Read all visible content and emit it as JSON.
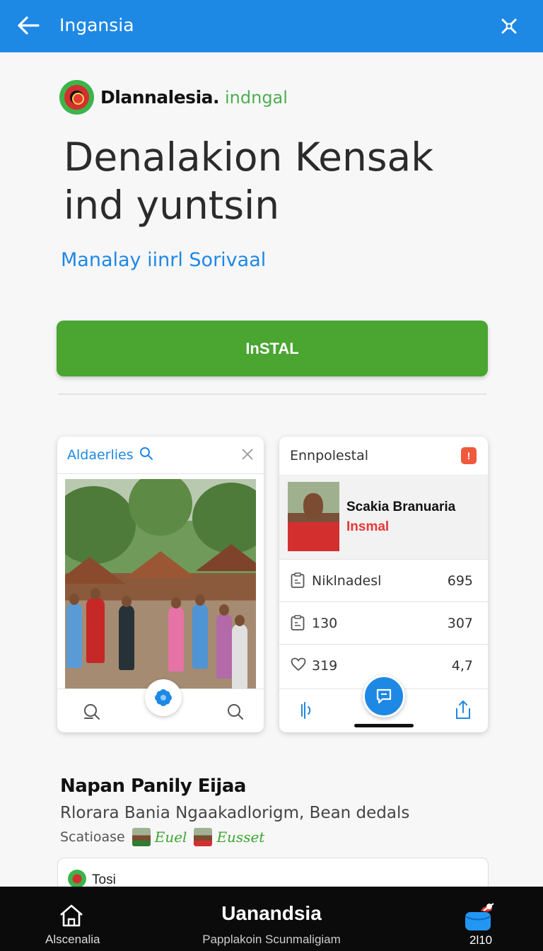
{
  "appbar": {
    "title": "Ingansia",
    "back_icon": "arrow-left-icon",
    "close_icon": "cross-icon"
  },
  "brand": {
    "name": "Dlannalesia.",
    "suffix": "indngal"
  },
  "headline": "Denalakion Kensak ind yuntsin",
  "subheadline": "Manalay iinrl Sorivaal",
  "install_label": "InSTAL",
  "screenshot_left": {
    "header_label": "Aldaerlies"
  },
  "screenshot_right": {
    "header_label": "Ennpolestal",
    "profile_name": "Scakia Branuaria",
    "profile_role": "Insmal",
    "rows": [
      {
        "label": "Niklnadesl",
        "value": "695",
        "icon": "clipboard-icon"
      },
      {
        "label": "130",
        "value": "307",
        "icon": "clipboard-icon"
      },
      {
        "label": "319",
        "value": "4,7",
        "icon": "heart-icon"
      }
    ]
  },
  "section": {
    "title": "Napan Panily Eijaa",
    "description": "Rlorara Bania Ngaakadlorigm, Bean dedals",
    "meta_label": "Scatioase",
    "tag1": "Euel",
    "tag2": "Eusset"
  },
  "tosi_label": "Tosi",
  "bottomnav": {
    "home_label": "Alscenalia",
    "brand_name": "Uanandsia",
    "brand_sub": "Papplakoin  Scunmaligiam",
    "bag_label": "2l10"
  },
  "colors": {
    "primary": "#1e88e5",
    "install": "#4aa531",
    "accent_red": "#e53935",
    "nav_bg": "#0b0b0b"
  }
}
